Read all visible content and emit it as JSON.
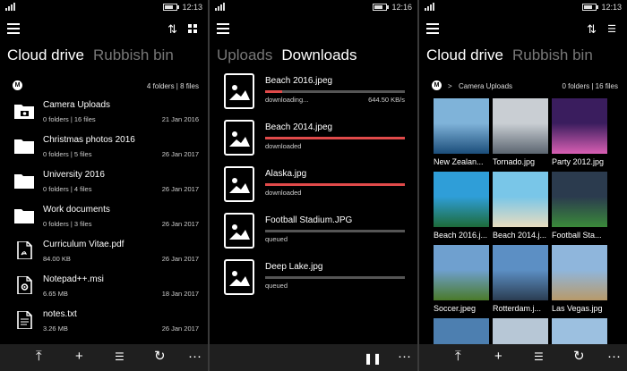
{
  "status": {
    "s1_time": "12:13",
    "s2_time": "12:16",
    "s3_time": "12:13"
  },
  "colors": {
    "progress": "#e04a4a",
    "track": "#555555",
    "bottombar": "#1f1f1f"
  },
  "screen1": {
    "tabs": [
      "Cloud drive",
      "Rubbish bin"
    ],
    "breadcrumb_icon": "mega-icon",
    "counts": "4 folders | 8 files",
    "rows": [
      {
        "name": "Camera Uploads",
        "meta": "0 folders | 16 files",
        "date": "21 Jan 2016",
        "icon": "camera-folder-icon"
      },
      {
        "name": "Christmas photos 2016",
        "meta": "0 folders | 5 files",
        "date": "26 Jan 2017",
        "icon": "folder-icon"
      },
      {
        "name": "University 2016",
        "meta": "0 folders | 4 files",
        "date": "26 Jan 2017",
        "icon": "folder-icon"
      },
      {
        "name": "Work documents",
        "meta": "0 folders | 3 files",
        "date": "26 Jan 2017",
        "icon": "folder-icon"
      },
      {
        "name": "Curriculum Vitae.pdf",
        "meta": "84.00 KB",
        "date": "26 Jan 2017",
        "icon": "pdf-file-icon"
      },
      {
        "name": "Notepad++.msi",
        "meta": "6.65 MB",
        "date": "18 Jan 2017",
        "icon": "installer-file-icon"
      },
      {
        "name": "notes.txt",
        "meta": "3.26 MB",
        "date": "26 Jan 2017",
        "icon": "text-file-icon"
      }
    ]
  },
  "screen2": {
    "tabs": [
      "Uploads",
      "Downloads"
    ],
    "items": [
      {
        "name": "Beach 2016.jpeg",
        "status": "downloading...",
        "speed": "644.50 KB/s",
        "progress": 0.12
      },
      {
        "name": "Beach 2014.jpeg",
        "status": "downloaded",
        "speed": "",
        "progress": 1.0
      },
      {
        "name": "Alaska.jpg",
        "status": "downloaded",
        "speed": "",
        "progress": 1.0
      },
      {
        "name": "Football Stadium.JPG",
        "status": "queued",
        "speed": "",
        "progress": 0.0
      },
      {
        "name": "Deep Lake.jpg",
        "status": "queued",
        "speed": "",
        "progress": 0.0
      }
    ]
  },
  "screen3": {
    "tabs": [
      "Cloud drive",
      "Rubbish bin"
    ],
    "path": "Camera Uploads",
    "counts": "0 folders | 16 files",
    "tiles": [
      {
        "caption": "New Zealan...",
        "colors": [
          "#7fb3d9",
          "#1b4d7a"
        ]
      },
      {
        "caption": "Tornado.jpg",
        "colors": [
          "#c9ced3",
          "#5b6570"
        ]
      },
      {
        "caption": "Party 2012.jpg",
        "colors": [
          "#3a1d5e",
          "#d85fb3"
        ]
      },
      {
        "caption": "Beach 2016.j...",
        "colors": [
          "#2f9ed8",
          "#1d6b3a"
        ]
      },
      {
        "caption": "Beach 2014.j...",
        "colors": [
          "#79c6e8",
          "#e8dcc0"
        ]
      },
      {
        "caption": "Football Sta...",
        "colors": [
          "#2b3b4e",
          "#3a8a3a"
        ]
      },
      {
        "caption": "Soccer.jpeg",
        "colors": [
          "#6fa0cf",
          "#4a7a2a"
        ]
      },
      {
        "caption": "Rotterdam.j...",
        "colors": [
          "#5c8fc4",
          "#2b3d52"
        ]
      },
      {
        "caption": "Las Vegas.jpg",
        "colors": [
          "#8fb6dc",
          "#b89a6a"
        ]
      },
      {
        "caption": "",
        "colors": [
          "#4d7fb0",
          "#2a3a4a"
        ]
      },
      {
        "caption": "",
        "colors": [
          "#b7c7d6",
          "#6a7580"
        ]
      },
      {
        "caption": "",
        "colors": [
          "#9cc0e0",
          "#d8d0c0"
        ]
      }
    ]
  },
  "bottombar": {
    "s1": [
      "upload-icon",
      "add-icon",
      "multiselect-icon",
      "refresh-icon",
      "more-icon"
    ],
    "s2": [
      "pause-icon",
      "more-icon"
    ],
    "s3": [
      "upload-icon",
      "add-icon",
      "multiselect-icon",
      "refresh-icon",
      "more-icon"
    ],
    "more_label": "···"
  }
}
